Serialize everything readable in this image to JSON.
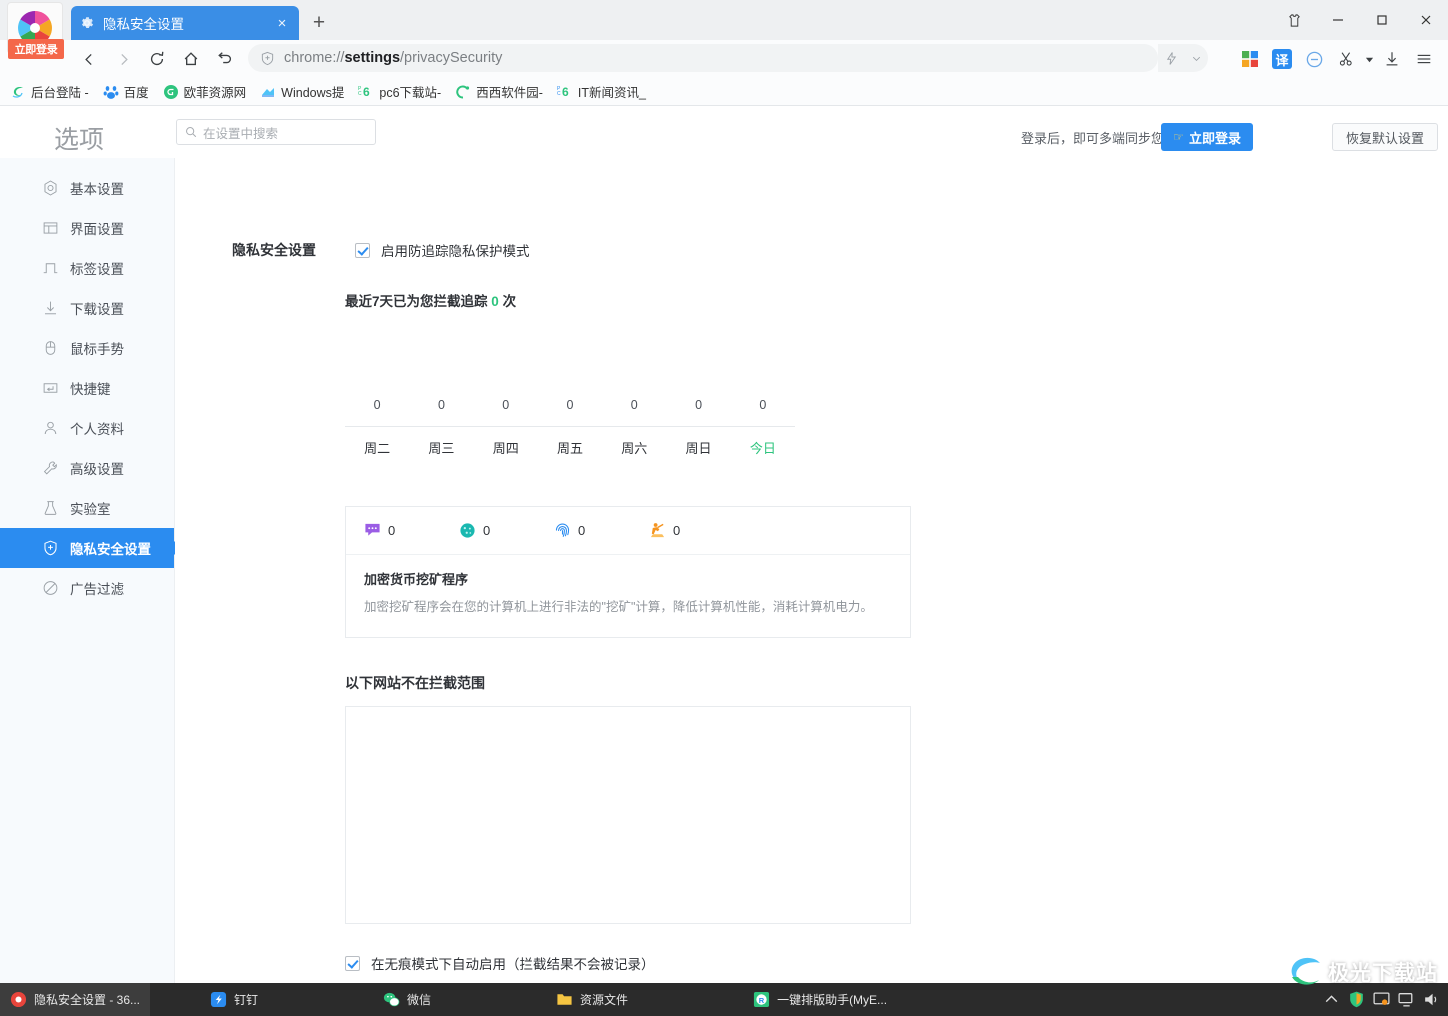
{
  "window": {
    "controls": [
      {
        "name": "skin-icon",
        "glyph": "skin"
      },
      {
        "name": "minimize",
        "glyph": "minimize"
      },
      {
        "name": "maximize",
        "glyph": "maximize"
      },
      {
        "name": "close",
        "glyph": "close"
      }
    ]
  },
  "browser": {
    "login_badge": "立即登录",
    "tab": {
      "title": "隐私安全设置",
      "close_label": "×",
      "icon": "gear-icon"
    },
    "new_tab_label": "+",
    "nav": {
      "back": "back-icon",
      "forward": "forward-icon",
      "reload": "reload-icon",
      "home": "home-icon",
      "undo": "undo-icon"
    },
    "address": {
      "prefix": "chrome://",
      "bold": "settings",
      "suffix": "/privacySecurity"
    },
    "toolbar_icons": [
      "lightning-icon",
      "chevron-down-icon",
      "microsoft-squares-icon",
      "translate-icon",
      "block-icon",
      "scissors-icon",
      "scissors-dropdown-icon",
      "download-icon",
      "menu-icon"
    ],
    "translate_label": "译",
    "bookmarks": [
      {
        "label": "后台登陆 -",
        "icon": "swirl-green-icon"
      },
      {
        "label": "百度",
        "icon": "baidu-paw-icon"
      },
      {
        "label": "欧菲资源网",
        "icon": "green-circle-icon"
      },
      {
        "label": "Windows提",
        "icon": "windows-blue-icon"
      },
      {
        "label": "pc6下载站-",
        "icon": "pc6-icon"
      },
      {
        "label": "西西软件园-",
        "icon": "cc-green-icon"
      },
      {
        "label": "IT新闻资讯_",
        "icon": "pc6-icon"
      }
    ]
  },
  "settings": {
    "title": "选项",
    "search": {
      "placeholder": "在设置中搜索",
      "icon": "search-icon"
    },
    "sync_note": "登录后，即可多端同步您的设置",
    "login_button": "立即登录",
    "reset_button": "恢复默认设置",
    "sidebar": [
      {
        "label": "基本设置",
        "icon": "settings-circle-icon"
      },
      {
        "label": "界面设置",
        "icon": "window-icon"
      },
      {
        "label": "标签设置",
        "icon": "tab-icon"
      },
      {
        "label": "下载设置",
        "icon": "download-arrow-icon"
      },
      {
        "label": "鼠标手势",
        "icon": "mouse-icon"
      },
      {
        "label": "快捷键",
        "icon": "keyboard-key-icon"
      },
      {
        "label": "个人资料",
        "icon": "user-icon"
      },
      {
        "label": "高级设置",
        "icon": "wrench-icon"
      },
      {
        "label": "实验室",
        "icon": "flask-icon"
      },
      {
        "label": "隐私安全设置",
        "icon": "shield-plus-icon",
        "active": true
      },
      {
        "label": "广告过滤",
        "icon": "no-entry-icon"
      }
    ],
    "main": {
      "section_title": "隐私安全设置",
      "enable_protection": {
        "label": "启用防追踪隐私保护模式",
        "checked": true
      },
      "stat_prefix": "最近7天已为您拦截追踪",
      "stat_count": "0",
      "stat_suffix": "次",
      "card": {
        "stats": [
          {
            "icon": "social-chat-icon",
            "value": "0",
            "color": "#9b5de5"
          },
          {
            "icon": "cookie-icon",
            "value": "0",
            "color": "#1ab8b0"
          },
          {
            "icon": "fingerprint-icon",
            "value": "0",
            "color": "#2b8cf0"
          },
          {
            "icon": "miner-icon",
            "value": "0",
            "color": "#f5941f"
          }
        ],
        "heading": "加密货币挖矿程序",
        "description": "加密挖矿程序会在您的计算机上进行非法的\"挖矿\"计算，降低计算机性能，消耗计算机电力。"
      },
      "whitelist_title": "以下网站不在拦截范围",
      "whitelist_value": "",
      "incognito": {
        "label": "在无痕模式下自动启用（拦截结果不会被记录）",
        "checked": true
      }
    }
  },
  "chart_data": {
    "type": "bar",
    "title": "最近7天已为您拦截追踪 0 次",
    "categories": [
      "周二",
      "周三",
      "周四",
      "周五",
      "周六",
      "周日",
      "今日"
    ],
    "values": [
      0,
      0,
      0,
      0,
      0,
      0,
      0
    ],
    "value_labels": [
      "0",
      "0",
      "0",
      "0",
      "0",
      "0",
      "0"
    ],
    "highlight_category": "今日",
    "highlight_color": "#2ec47e",
    "xlabel": "",
    "ylabel": "",
    "ylim": [
      0,
      1
    ],
    "grid": false,
    "legend": "none"
  },
  "taskbar": {
    "items": [
      {
        "label": "隐私安全设置 - 36...",
        "icon": "browser-icon",
        "selected": true
      },
      {
        "label": "钉钉",
        "icon": "dingtalk-icon"
      },
      {
        "label": "微信",
        "icon": "wechat-icon"
      },
      {
        "label": "资源文件",
        "icon": "folder-icon"
      },
      {
        "label": "一键排版助手(MyE...",
        "icon": "typesetting-icon"
      }
    ],
    "tray": [
      "chevron-up-icon",
      "shield-icon",
      "monitor-icon",
      "display-icon",
      "volume-icon"
    ]
  },
  "watermark": {
    "text": "极光下载站"
  }
}
